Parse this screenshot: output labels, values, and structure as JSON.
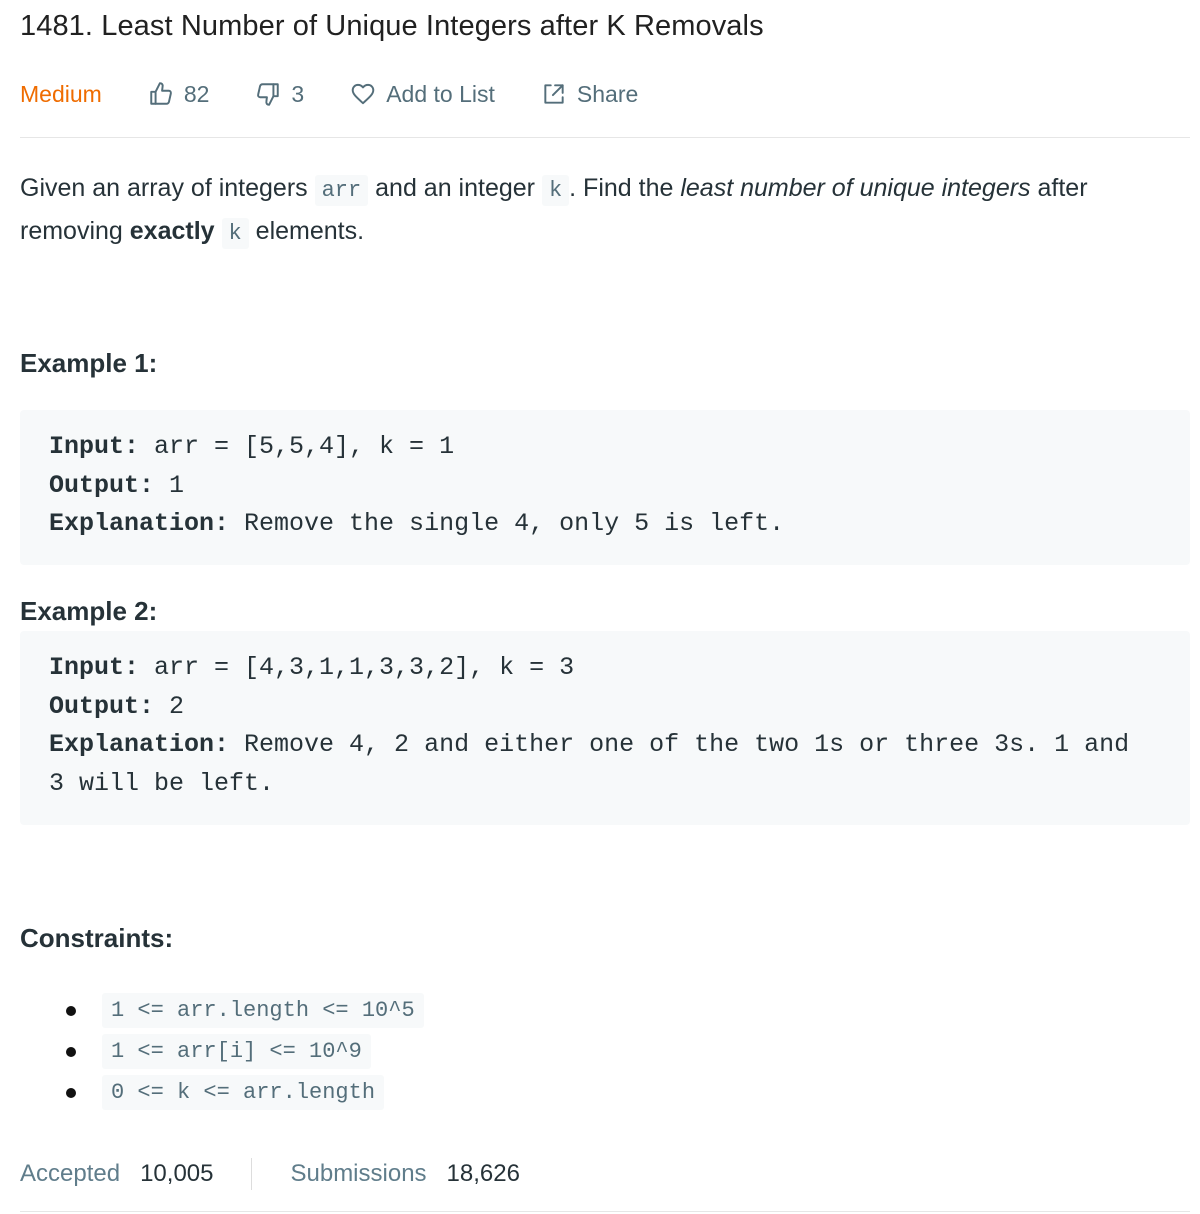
{
  "problem": {
    "title": "1481. Least Number of Unique Integers after K Removals"
  },
  "meta": {
    "difficulty": "Medium",
    "difficulty_color": "#ef6c00",
    "likes": "82",
    "dislikes": "3",
    "add_to_list": "Add to List",
    "share": "Share",
    "icons": [
      "thumbs-up-icon",
      "thumbs-down-icon",
      "heart-icon",
      "share-icon"
    ]
  },
  "description": {
    "p1": "Given an array of integers ",
    "code_arr": "arr",
    "p2": " and an integer ",
    "code_k": "k",
    "p3": ". Find the ",
    "em": "least number of unique integers",
    "p4": " after removing ",
    "strong": "exactly",
    "p5": " ",
    "code_k2": "k",
    "p6": " elements."
  },
  "example1": {
    "heading": "Example 1:",
    "input_label": "Input:",
    "input_value": " arr = [5,5,4], k = 1",
    "output_label": "Output:",
    "output_value": " 1",
    "explanation_label": "Explanation:",
    "explanation_value": " Remove the single 4, only 5 is left."
  },
  "example2": {
    "heading": "Example 2:",
    "input_label": "Input:",
    "input_value": " arr = [4,3,1,1,3,3,2], k = 3",
    "output_label": "Output:",
    "output_value": " 2",
    "explanation_label": "Explanation:",
    "explanation_value": " Remove 4, 2 and either one of the two 1s or three 3s. 1 and",
    "explanation_cont": "3 will be left."
  },
  "constraints": {
    "heading": "Constraints:",
    "items": [
      "1 <= arr.length <= 10^5",
      "1 <= arr[i] <= 10^9",
      "0 <= k <= arr.length"
    ]
  },
  "stats": {
    "accepted_label": "Accepted",
    "accepted_value": "10,005",
    "submissions_label": "Submissions",
    "submissions_value": "18,626"
  }
}
